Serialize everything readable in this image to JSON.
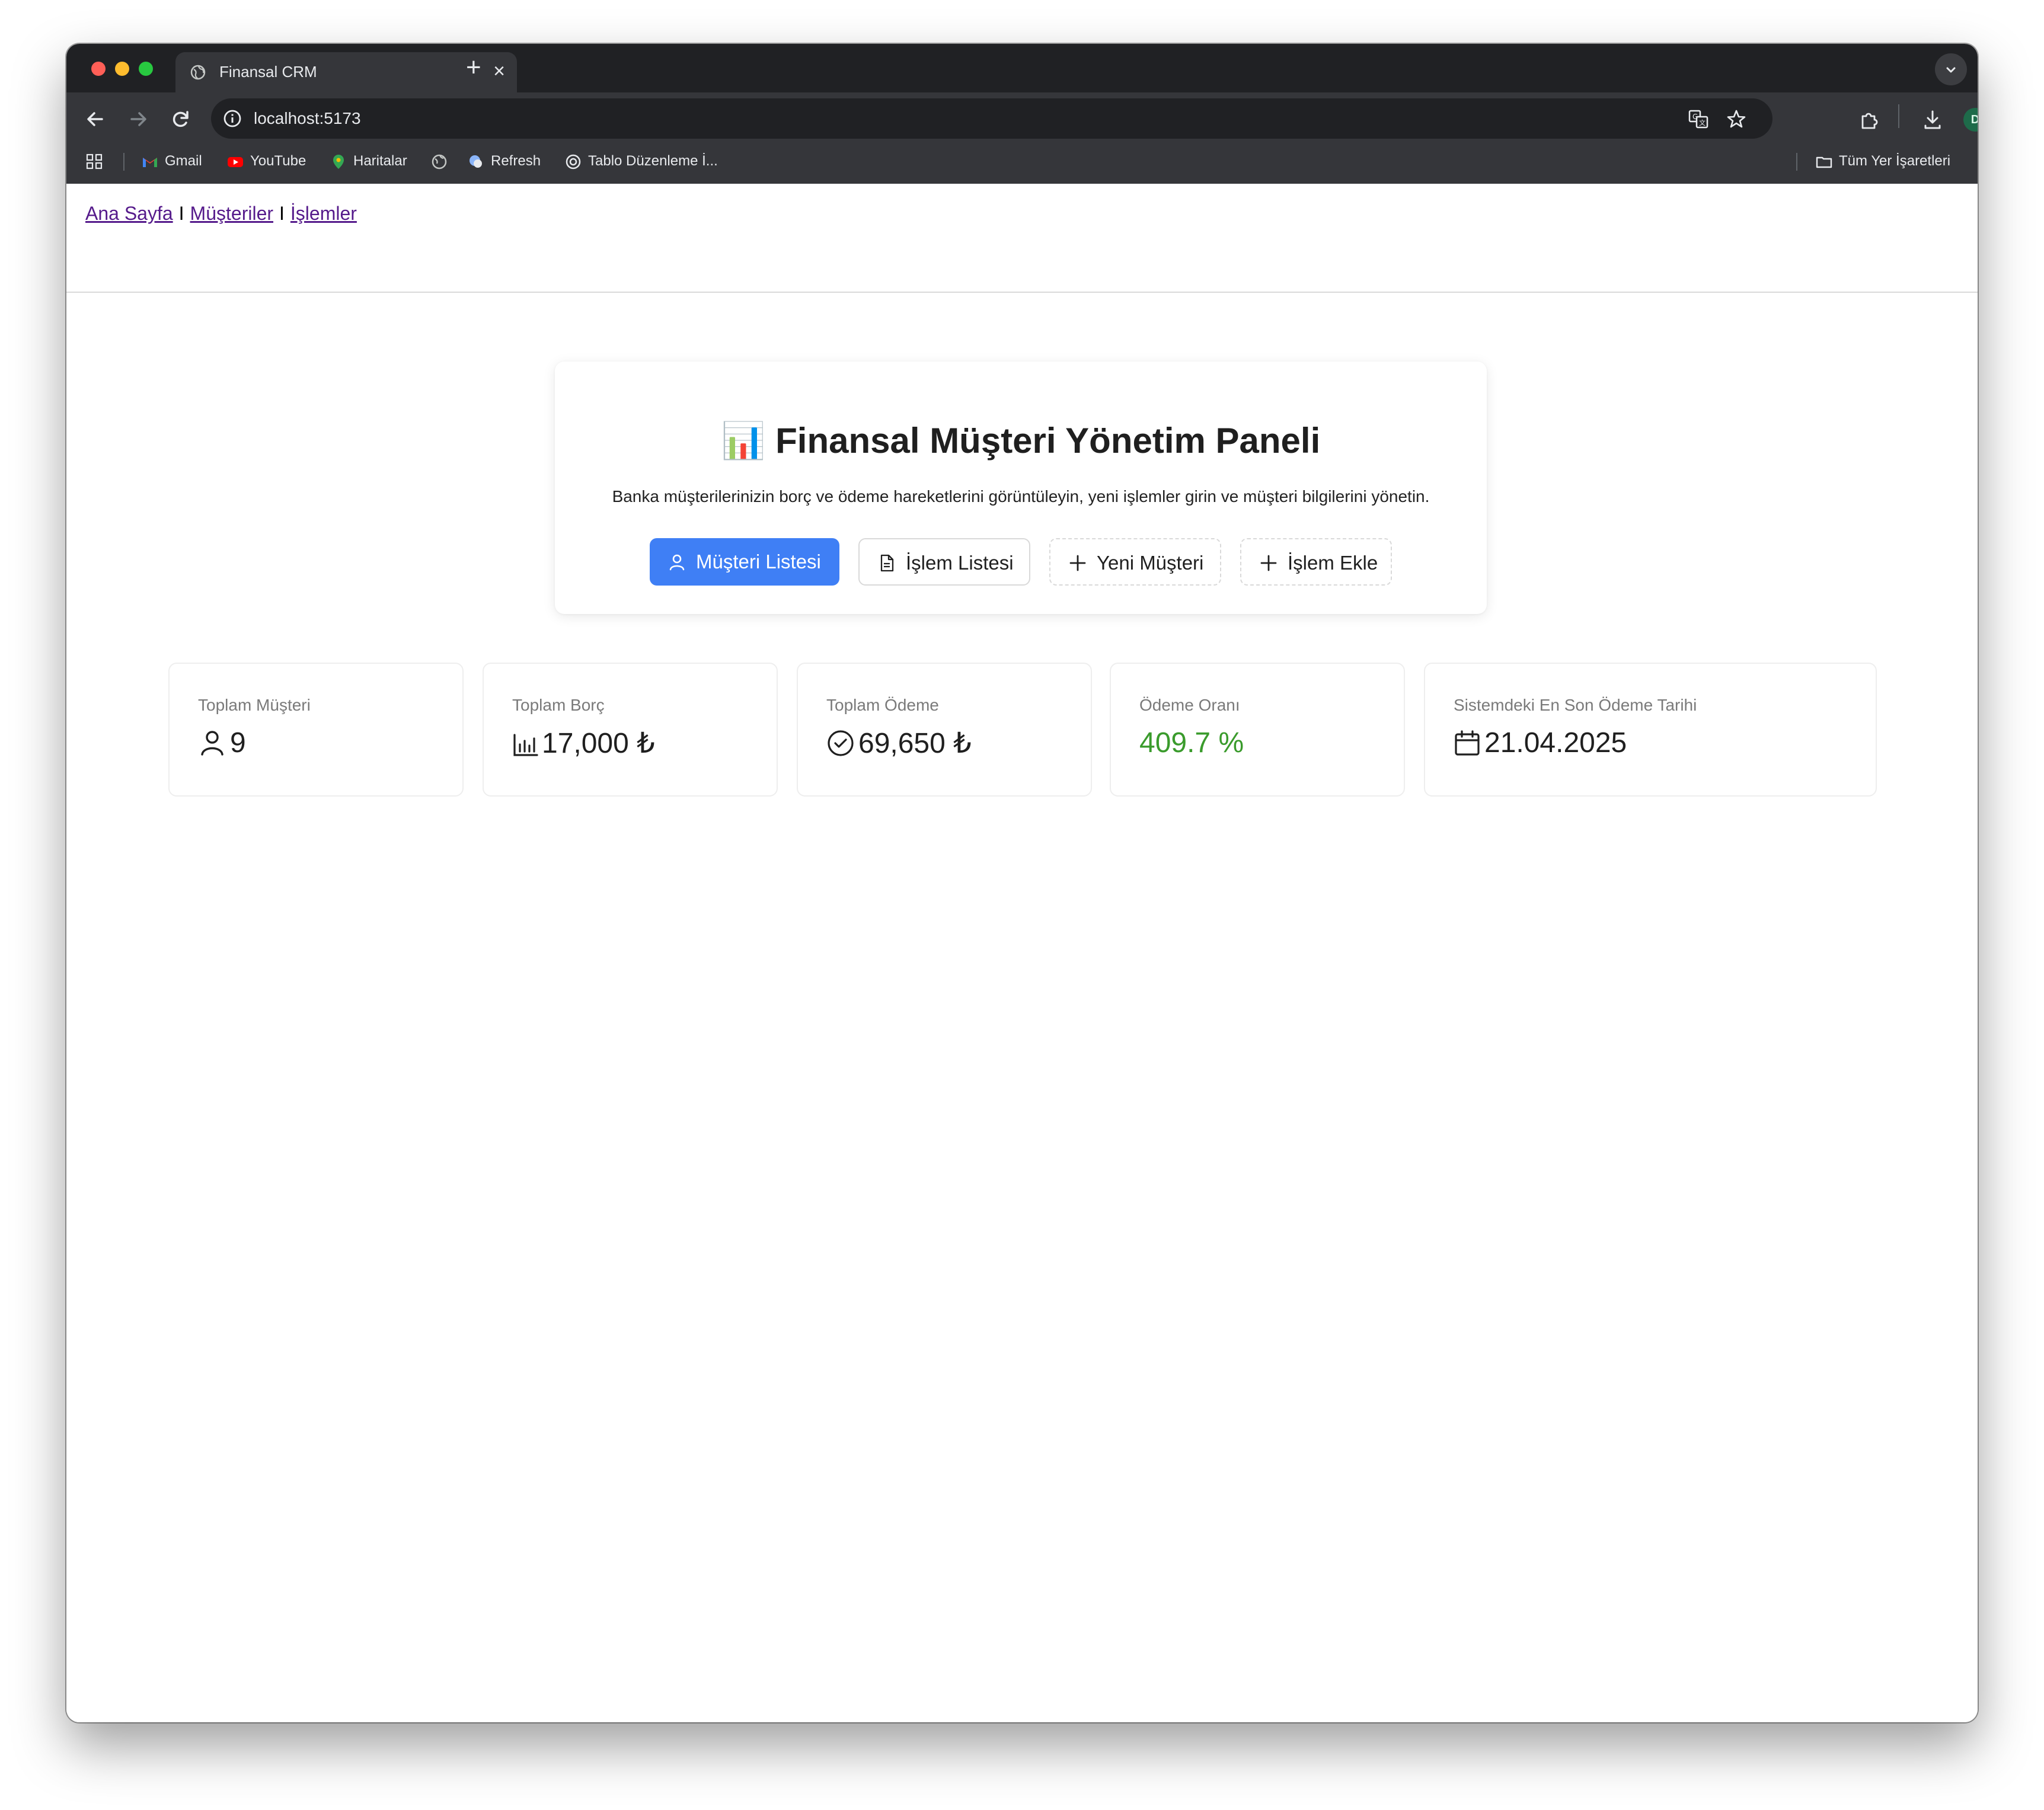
{
  "browser": {
    "tab_title": "Finansal CRM",
    "url": "localhost:5173",
    "profile_initial": "D",
    "bookmarks": [
      "Gmail",
      "YouTube",
      "Haritalar",
      "Refresh",
      "Tablo Düzenleme İ..."
    ],
    "all_bookmarks": "Tüm Yer İşaretleri"
  },
  "nav": {
    "home": "Ana Sayfa",
    "customers": "Müşteriler",
    "transactions": "İşlemler",
    "separator": "I"
  },
  "hero": {
    "emoji": "📊",
    "title": "Finansal Müşteri Yönetim Paneli",
    "subtitle": "Banka müşterilerinizin borç ve ödeme hareketlerini görüntüleyin, yeni işlemler girin ve müşteri bilgilerini yönetin.",
    "buttons": {
      "customer_list": "Müşteri Listesi",
      "transaction_list": "İşlem Listesi",
      "new_customer": "Yeni Müşteri",
      "add_transaction": "İşlem Ekle"
    }
  },
  "stats": [
    {
      "label": "Toplam Müşteri",
      "value": "9"
    },
    {
      "label": "Toplam Borç",
      "value": "17,000 ₺"
    },
    {
      "label": "Toplam Ödeme",
      "value": "69,650 ₺"
    },
    {
      "label": "Ödeme Oranı",
      "value": "409.7 %"
    },
    {
      "label": "Sistemdeki En Son Ödeme Tarihi",
      "value": "21.04.2025"
    }
  ],
  "colors": {
    "primary": "#3f7ff5",
    "rate_green": "#3a9b2c"
  }
}
